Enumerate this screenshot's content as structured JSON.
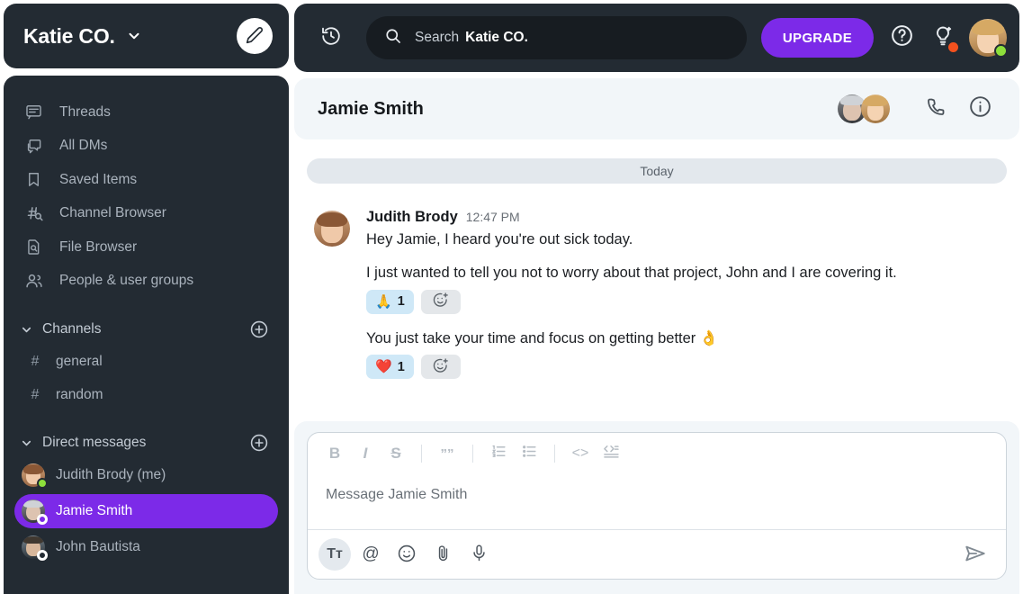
{
  "workspace": {
    "name": "Katie CO.",
    "chevron_icon": "chevron-down-icon",
    "compose_icon": "pencil-icon"
  },
  "sidebar": {
    "nav": [
      {
        "label": "Threads",
        "icon": "threads-icon"
      },
      {
        "label": "All DMs",
        "icon": "all-dms-icon"
      },
      {
        "label": "Saved Items",
        "icon": "bookmark-icon"
      },
      {
        "label": "Channel Browser",
        "icon": "channel-browser-icon"
      },
      {
        "label": "File Browser",
        "icon": "file-browser-icon"
      },
      {
        "label": "People & user groups",
        "icon": "people-icon"
      }
    ],
    "channels_section": {
      "label": "Channels",
      "add_icon": "plus-circle-icon",
      "twisty_icon": "chevron-down-icon",
      "items": [
        {
          "label": "general",
          "prefix": "#"
        },
        {
          "label": "random",
          "prefix": "#"
        }
      ]
    },
    "dms_section": {
      "label": "Direct messages",
      "add_icon": "plus-circle-icon",
      "twisty_icon": "chevron-down-icon",
      "items": [
        {
          "label": "Judith Brody (me)",
          "presence": "online",
          "active": false
        },
        {
          "label": "Jamie Smith",
          "presence": "away",
          "active": true
        },
        {
          "label": "John Bautista",
          "presence": "away",
          "active": false
        }
      ]
    }
  },
  "topbar": {
    "history_icon": "history-icon",
    "search": {
      "icon": "search-icon",
      "placeholder": "Search",
      "workspace": "Katie CO."
    },
    "upgrade_label": "UPGRADE",
    "help_icon": "help-circle-icon",
    "whats_new_icon": "lightbulb-icon",
    "avatar_icon": "user-avatar",
    "presence": "online"
  },
  "conversation": {
    "title": "Jamie Smith",
    "members_icon": "member-avatars",
    "call_icon": "phone-icon",
    "info_icon": "info-circle-icon",
    "day_divider": "Today",
    "messages": [
      {
        "author": "Judith Brody",
        "time": "12:47 PM",
        "avatar": "judith-avatar",
        "lines": [
          {
            "text": "Hey Jamie, I heard you're out sick today.",
            "reactions": []
          },
          {
            "text": "I just wanted to tell you not to worry about that project, John and I are covering it.",
            "reactions": [
              {
                "emoji": "🙏",
                "count": "1"
              }
            ]
          },
          {
            "text": "You just take your time and focus on getting better 👌",
            "reactions": [
              {
                "emoji": "❤️",
                "count": "1"
              }
            ]
          }
        ]
      }
    ],
    "add_reaction_icon": "add-reaction-icon"
  },
  "composer": {
    "placeholder": "Message Jamie Smith",
    "format_buttons": [
      {
        "label": "B",
        "icon": "bold-icon"
      },
      {
        "label": "I",
        "icon": "italic-icon"
      },
      {
        "label": "S",
        "icon": "strikethrough-icon"
      },
      {
        "label": "””",
        "icon": "blockquote-icon"
      },
      {
        "label": "",
        "icon": "ordered-list-icon"
      },
      {
        "label": "",
        "icon": "bulleted-list-icon"
      },
      {
        "label": "<>",
        "icon": "code-icon"
      },
      {
        "label": "",
        "icon": "code-block-icon"
      }
    ],
    "action_buttons": [
      {
        "icon": "formatting-icon",
        "label": "Tт",
        "selected": true
      },
      {
        "icon": "mention-icon",
        "label": "@",
        "selected": false
      },
      {
        "icon": "emoji-icon",
        "label": "",
        "selected": false
      },
      {
        "icon": "attachment-icon",
        "label": "",
        "selected": false
      },
      {
        "icon": "microphone-icon",
        "label": "",
        "selected": false
      }
    ],
    "send_icon": "send-icon"
  },
  "colors": {
    "sidebar_bg": "#232b33",
    "accent_purple": "#7c2ae8",
    "panel_light": "#f2f6f9",
    "reaction_pill": "#cfe8f7",
    "presence_online": "#8ddf3b",
    "badge_orange": "#f4511e",
    "day_divider_bg": "#e3e8ed"
  }
}
